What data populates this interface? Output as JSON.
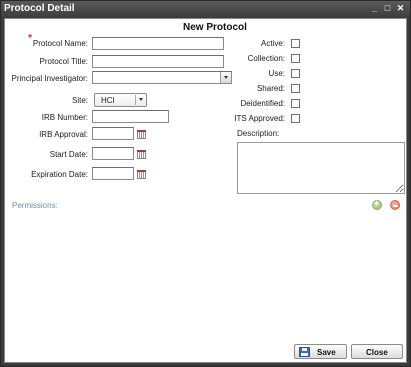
{
  "window": {
    "title": "Protocol Detail",
    "minimize": "_",
    "restore": "□",
    "close": "✕"
  },
  "form": {
    "heading": "New Protocol",
    "protocol_name_label": "Protocol Name:",
    "protocol_name_value": "",
    "protocol_title_label": "Protocol Title:",
    "protocol_title_value": "",
    "pi_label": "Principal Investigator:",
    "pi_value": "",
    "site_label": "Site:",
    "site_value": "HCI",
    "irb_number_label": "IRB Number:",
    "irb_number_value": "",
    "irb_approval_label": "IRB Approval:",
    "irb_approval_value": "",
    "start_date_label": "Start Date:",
    "start_date_value": "",
    "expiration_date_label": "Expiration Date:",
    "expiration_date_value": "",
    "required_marker": "*"
  },
  "flags": {
    "active": "Active:",
    "collection": "Collection:",
    "use": "Use:",
    "shared": "Shared:",
    "deidentified": "Deidentified:",
    "its_approved": "ITS Approved:"
  },
  "flags_checked": {
    "active": false,
    "collection": false,
    "use": false,
    "shared": false,
    "deidentified": false,
    "its_approved": false
  },
  "description": {
    "label": "Description:",
    "value": ""
  },
  "permissions": {
    "label": "Permissions:"
  },
  "buttons": {
    "save": "Save",
    "close": "Close"
  },
  "icons": {
    "add": "add-icon",
    "remove": "remove-icon",
    "calendar": "calendar-icon",
    "save": "floppy-disk-icon"
  },
  "colors": {
    "titlebar": "#3d3d3d",
    "required": "#dd2222",
    "permissions_text": "#6a8fb0",
    "add": "#8cbf5b",
    "remove": "#e06f55"
  }
}
